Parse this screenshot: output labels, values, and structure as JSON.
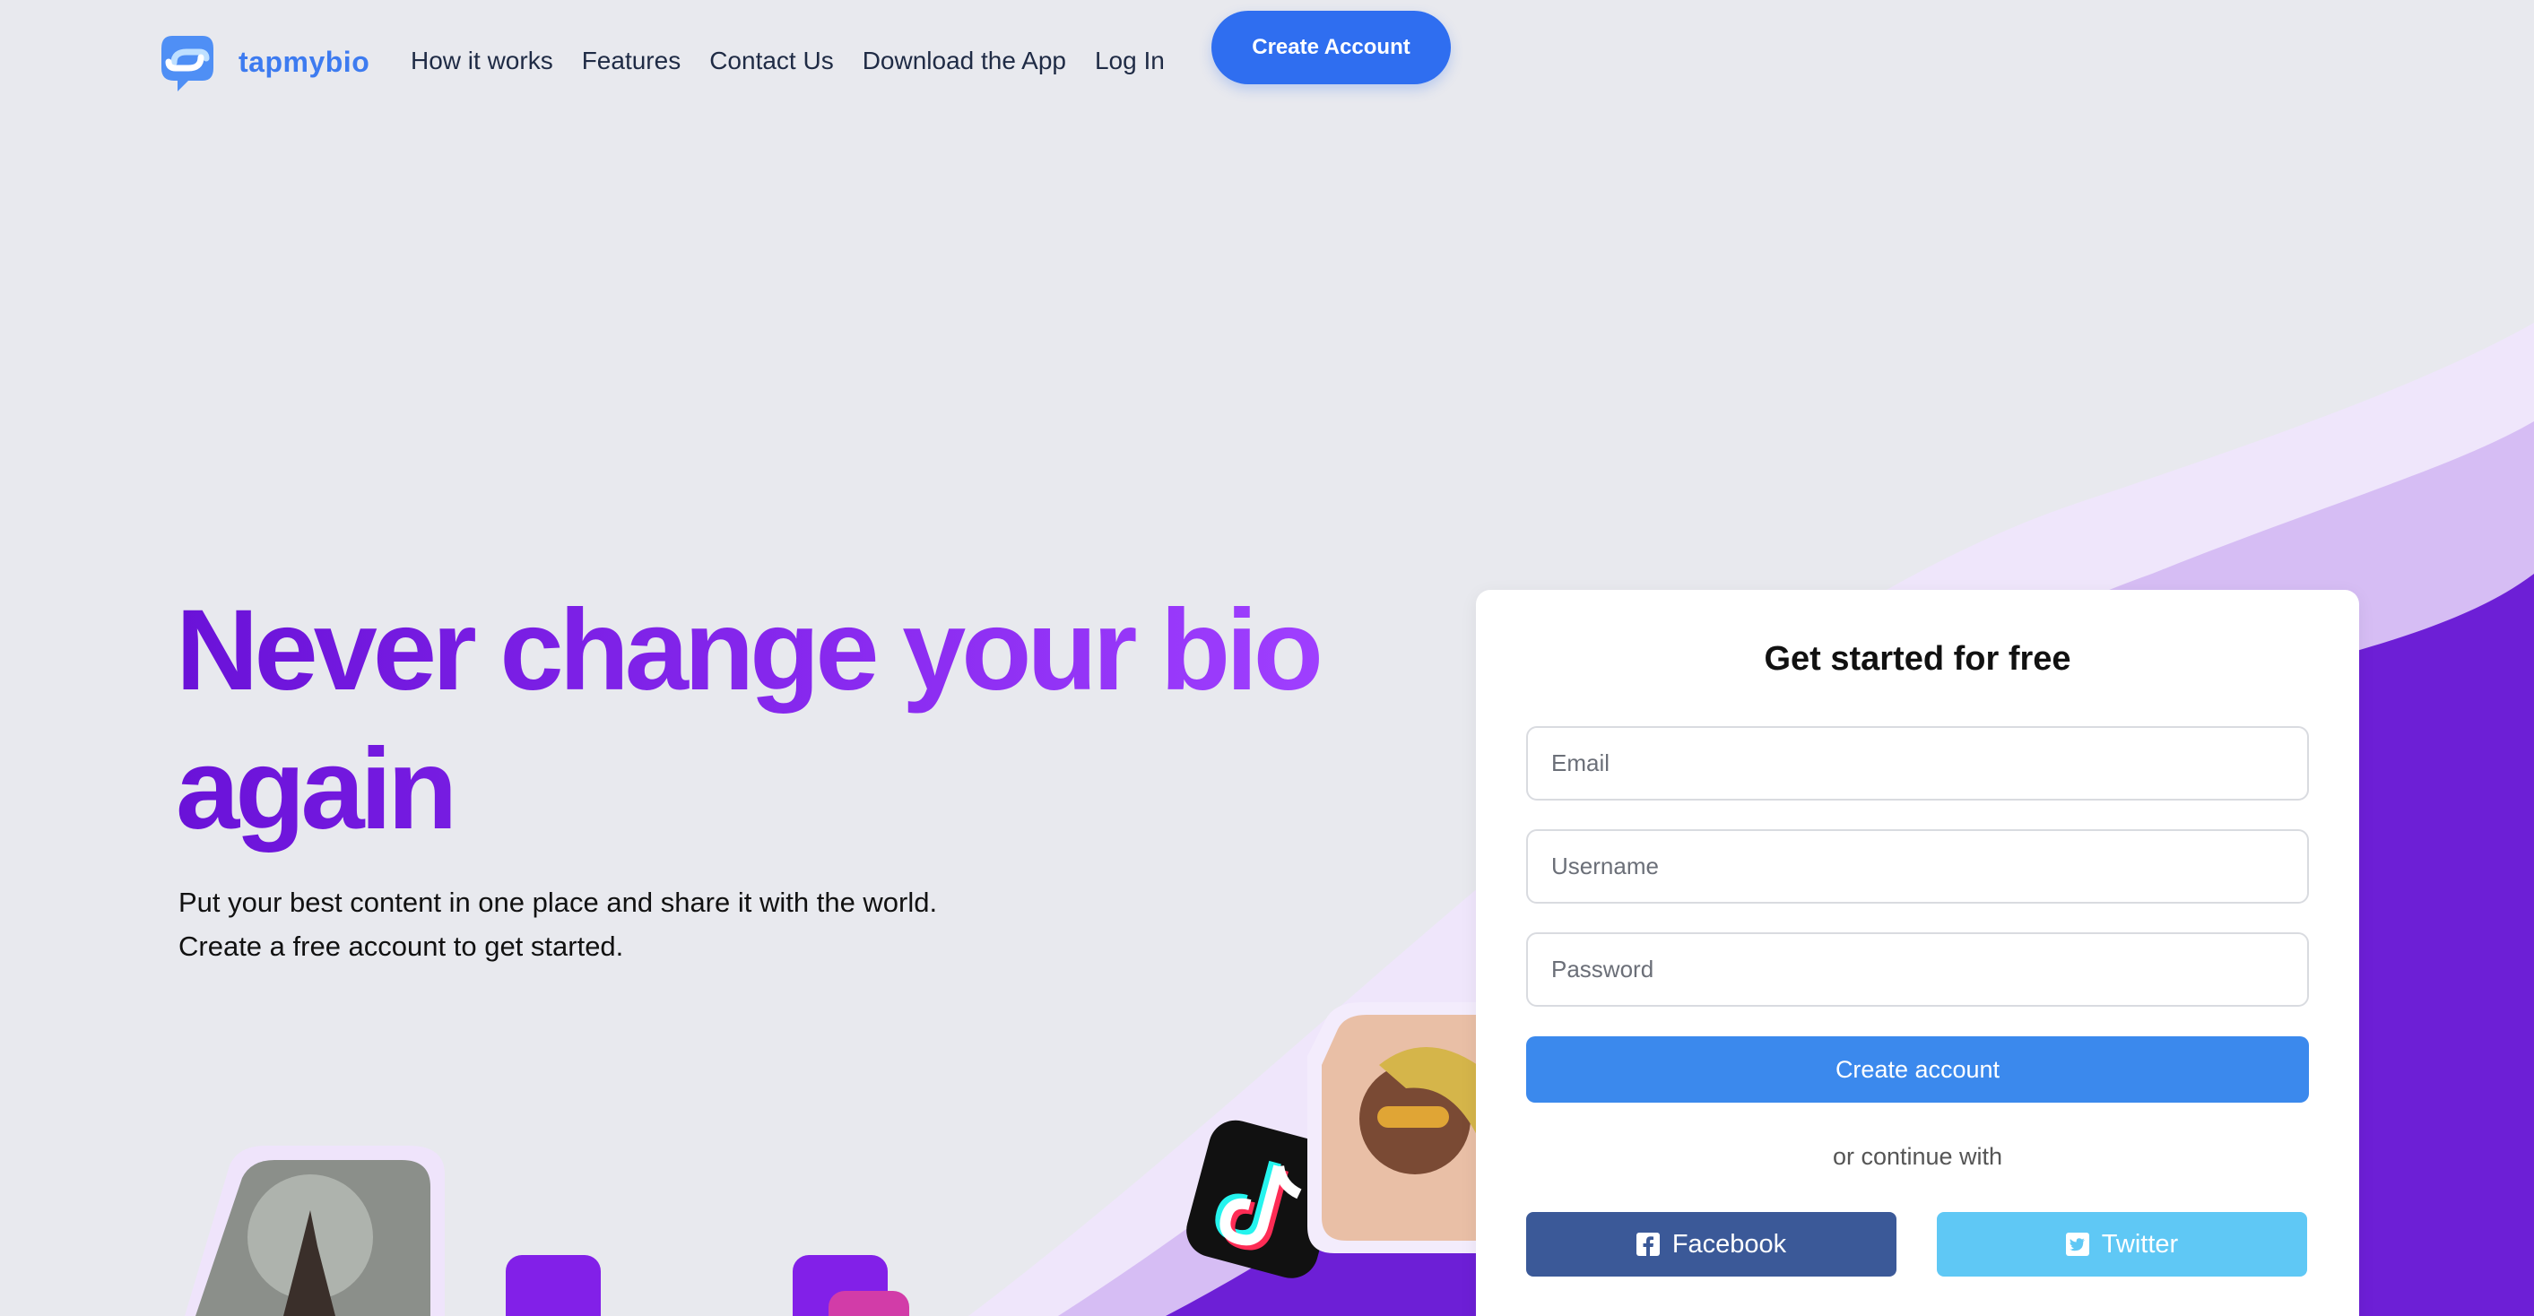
{
  "brand": {
    "name": "tapmybio",
    "logo_icon": "chat-bubble-link-icon"
  },
  "nav": {
    "items": [
      "How it works",
      "Features",
      "Contact Us",
      "Download the App",
      "Log In"
    ],
    "cta_label": "Create Account"
  },
  "hero": {
    "title": "Never change your bio again",
    "subtitle_line1": "Put your best content in one place and share it with the world.",
    "subtitle_line2": "Create a free account to get started."
  },
  "signup": {
    "title": "Get started for free",
    "email_placeholder": "Email",
    "username_placeholder": "Username",
    "password_placeholder": "Password",
    "submit_label": "Create account",
    "divider_text": "or continue with",
    "facebook_label": "Facebook",
    "twitter_label": "Twitter"
  },
  "colors": {
    "brand_blue": "#2f6ef0",
    "hero_purple": "#6a12d8",
    "facebook": "#3b5998",
    "twitter": "#5fc8f5"
  }
}
